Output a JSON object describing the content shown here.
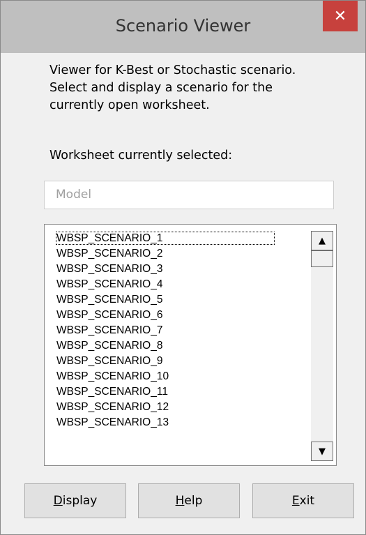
{
  "window": {
    "title": "Scenario Viewer",
    "close_glyph": "✕"
  },
  "description": {
    "lines": [
      "Viewer for K-Best or Stochastic scenario.",
      "Select and display a scenario for the",
      "currently open worksheet."
    ]
  },
  "worksheet": {
    "label": "Worksheet currently selected:",
    "placeholder": "Model"
  },
  "scenario_list": {
    "items": [
      "WBSP_SCENARIO_1",
      "WBSP_SCENARIO_2",
      "WBSP_SCENARIO_3",
      "WBSP_SCENARIO_4",
      "WBSP_SCENARIO_5",
      "WBSP_SCENARIO_6",
      "WBSP_SCENARIO_7",
      "WBSP_SCENARIO_8",
      "WBSP_SCENARIO_9",
      "WBSP_SCENARIO_10",
      "WBSP_SCENARIO_11",
      "WBSP_SCENARIO_12",
      "WBSP_SCENARIO_13"
    ],
    "scroll_up_glyph": "▲",
    "scroll_down_glyph": "▼"
  },
  "buttons": {
    "display": {
      "mnemonic": "D",
      "rest": "isplay"
    },
    "help": {
      "mnemonic": "H",
      "rest": "elp"
    },
    "exit": {
      "mnemonic": "E",
      "rest": "xit"
    }
  },
  "colors": {
    "titlebar": "#bfbfbf",
    "close_button": "#c7413d",
    "dialog_background": "#f0f0f0"
  }
}
